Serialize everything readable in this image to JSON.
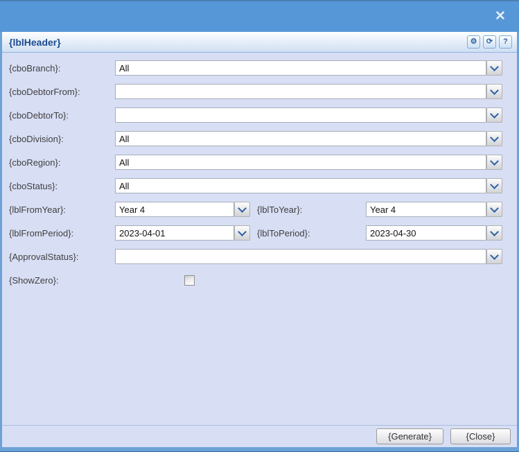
{
  "titlebar": {
    "close_glyph": "✕"
  },
  "header": {
    "title": "{lblHeader}",
    "buttons": [
      {
        "name": "gear-icon",
        "glyph": "⚙"
      },
      {
        "name": "refresh-icon",
        "glyph": "⟳"
      },
      {
        "name": "help-icon",
        "glyph": "?"
      }
    ]
  },
  "form": {
    "rows": [
      {
        "label": "{cboBranch}:",
        "value": "All"
      },
      {
        "label": "{cboDebtorFrom}:",
        "value": ""
      },
      {
        "label": "{cboDebtorTo}:",
        "value": ""
      },
      {
        "label": "{cboDivision}:",
        "value": "All"
      },
      {
        "label": "{cboRegion}:",
        "value": "All"
      },
      {
        "label": "{cboStatus}:",
        "value": "All"
      }
    ],
    "year_row": {
      "from_label": "{lblFromYear}:",
      "from_value": "Year 4",
      "to_label": "{lblToYear}:",
      "to_value": "Year 4"
    },
    "period_row": {
      "from_label": "{lblFromPeriod}:",
      "from_value": "2023-04-01",
      "to_label": "{lblToPeriod}:",
      "to_value": "2023-04-30"
    },
    "approval_row": {
      "label": "{ApprovalStatus}:",
      "value": ""
    },
    "show_zero_row": {
      "label": "{ShowZero}:",
      "checked": false
    }
  },
  "footer": {
    "generate": "{Generate}",
    "close": "{Close}"
  },
  "colors": {
    "titlebar": "#5697d7",
    "window_border": "#6ba2d8",
    "body_bg": "#d8def4",
    "header_text": "#1c4a92",
    "combo_chevron": "#2b5ea7"
  }
}
